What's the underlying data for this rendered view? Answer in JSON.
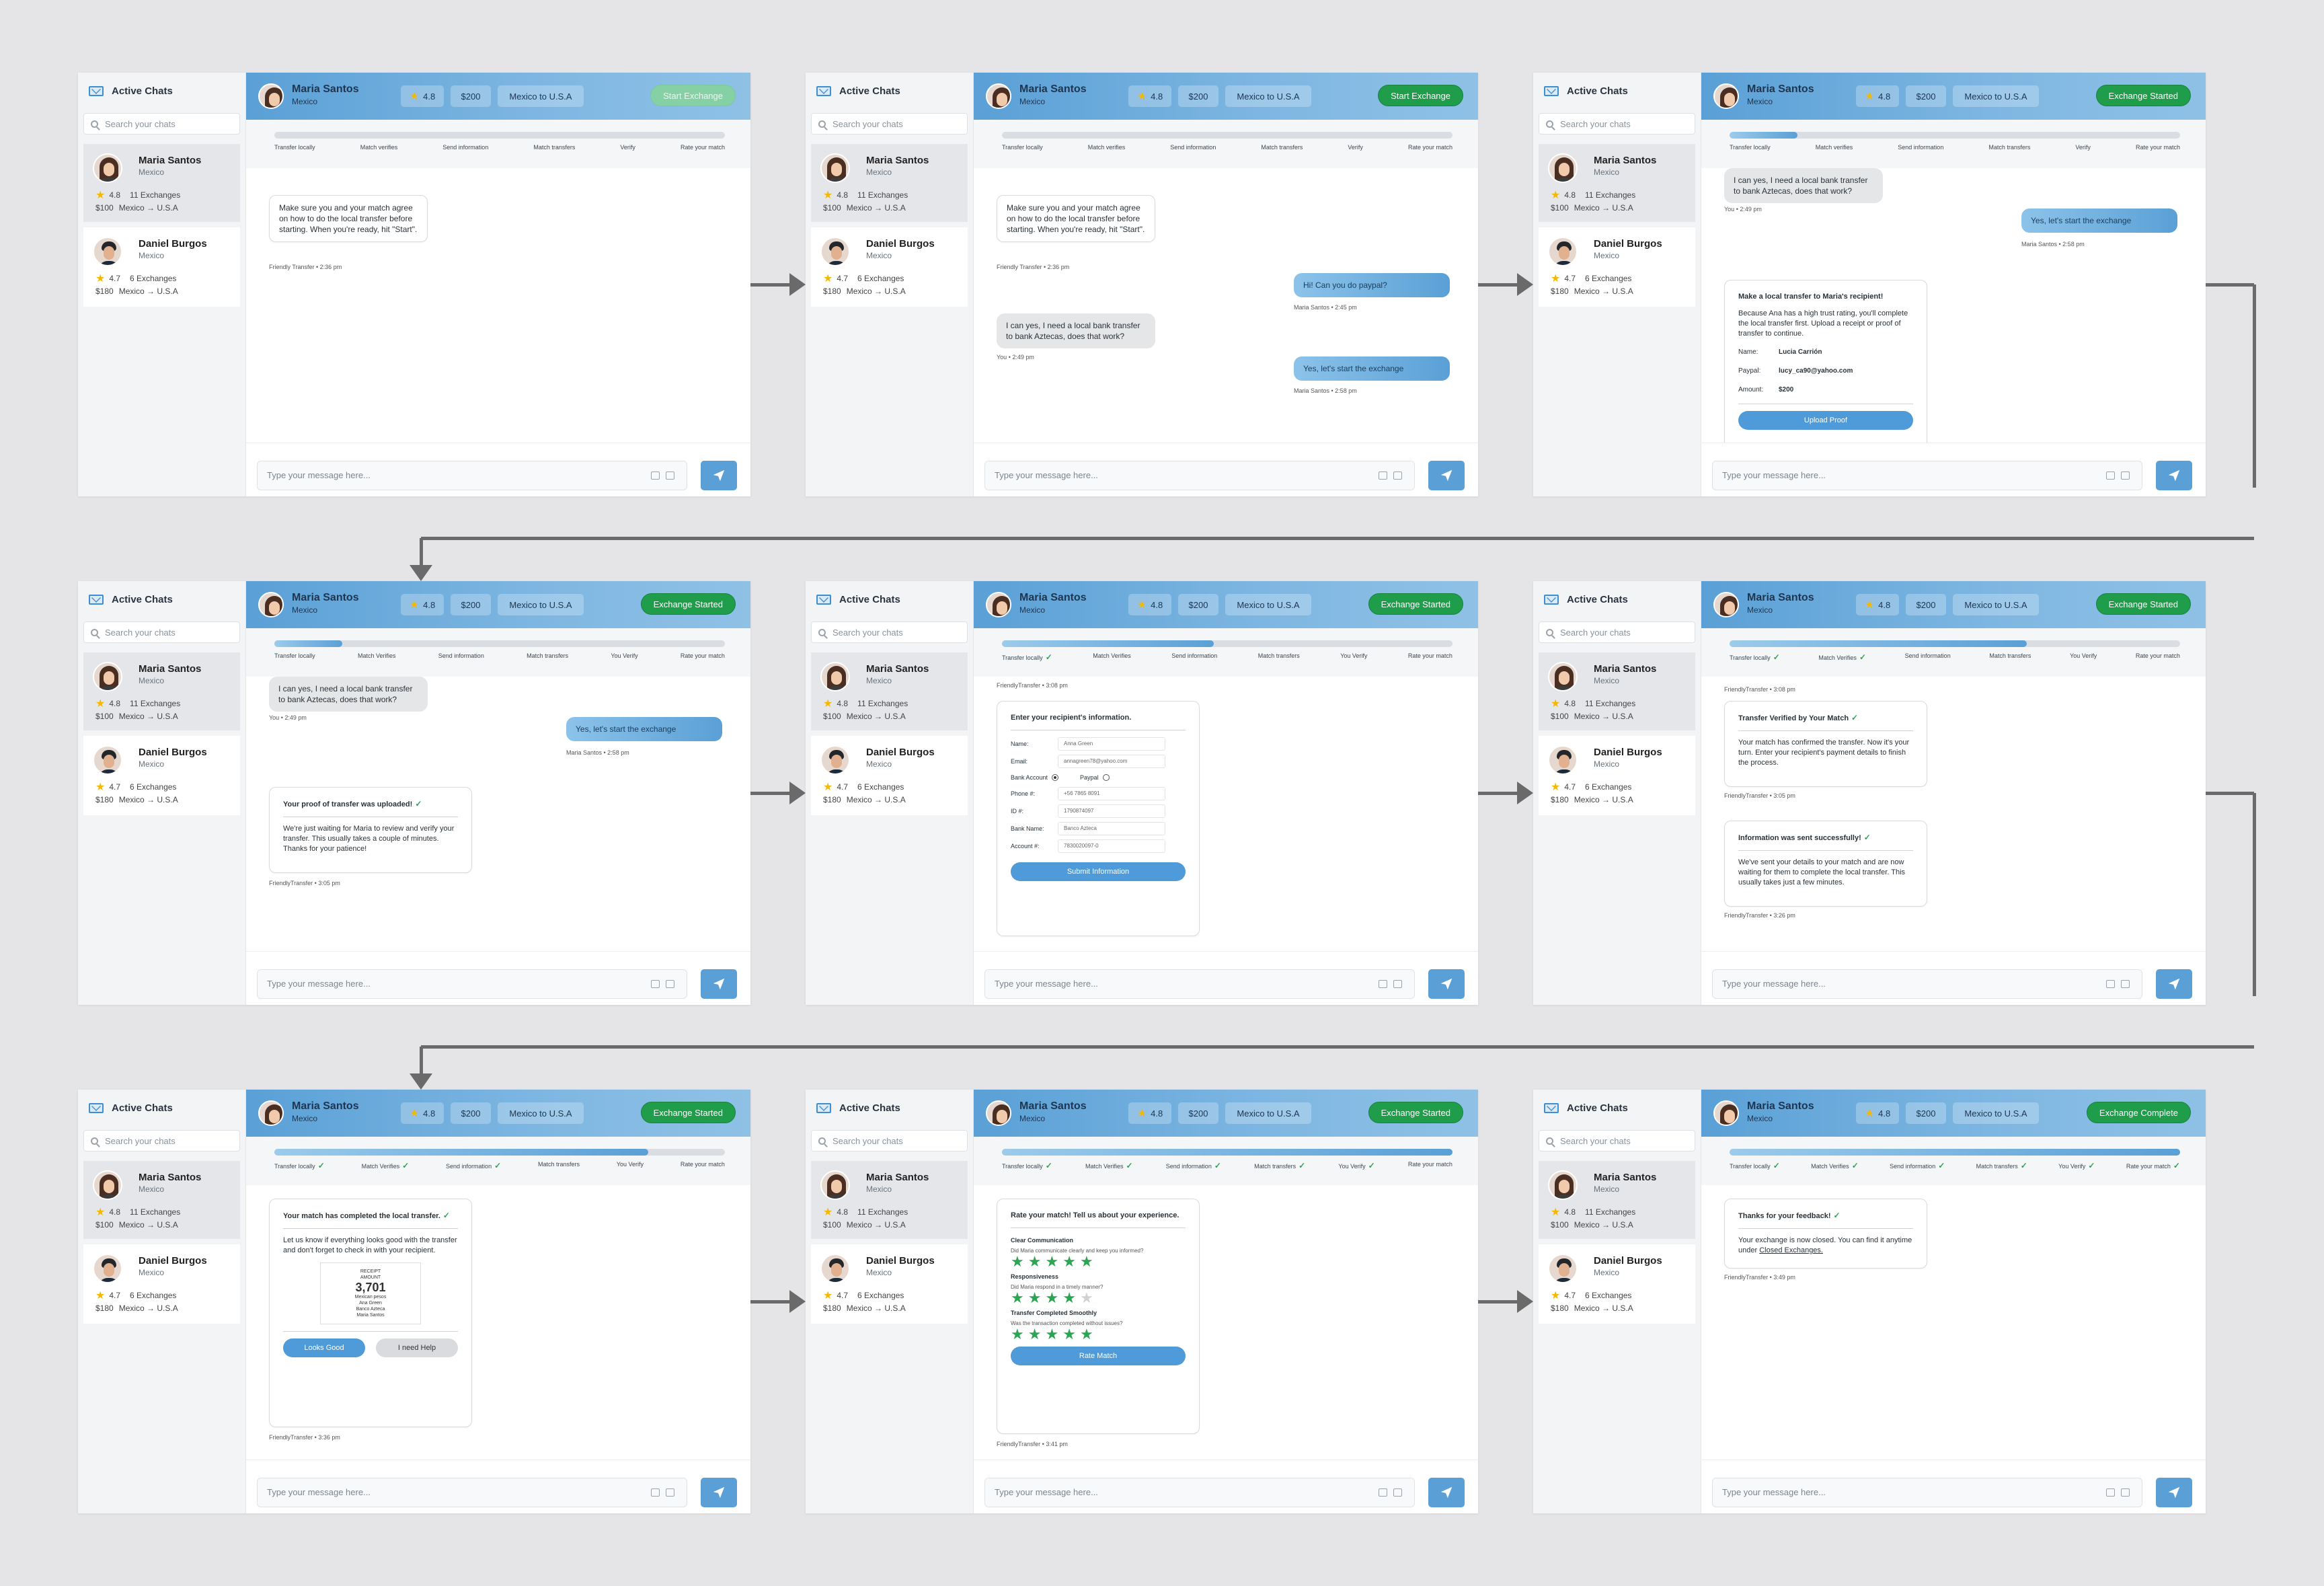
{
  "sidebar": {
    "title": "Active Chats",
    "search_placeholder": "Search your chats",
    "contacts": [
      {
        "name": "Maria Santos",
        "country": "Mexico",
        "rating": "4.8",
        "exchanges": "11 Exchanges",
        "amount": "$100",
        "route": "Mexico → U.S.A"
      },
      {
        "name": "Daniel Burgos",
        "country": "Mexico",
        "rating": "4.7",
        "exchanges": "6 Exchanges",
        "amount": "$180",
        "route": "Mexico → U.S.A"
      }
    ]
  },
  "header": {
    "name": "Maria Santos",
    "country": "Mexico",
    "rating": "4.8",
    "amount": "$200",
    "route": "Mexico to U.S.A"
  },
  "buttons": {
    "start": "Start Exchange",
    "started": "Exchange Started",
    "complete": "Exchange Complete"
  },
  "steps": [
    "Transfer locally",
    "Match verifies",
    "Send information",
    "Match transfers",
    "Verify",
    "Rate your match"
  ],
  "steps_later": [
    "Transfer locally",
    "Match Verifies",
    "Send information",
    "Match transfers",
    "You Verify",
    "Rate your match"
  ],
  "input_placeholder": "Type your message here...",
  "frames": [
    {
      "button": "start_dim",
      "progress": 0.0
    },
    {
      "button": "start",
      "progress": 0.0
    },
    {
      "button": "started",
      "progress": 0.15
    },
    {
      "button": "started",
      "progress": 0.15
    },
    {
      "button": "started",
      "progress": 0.47
    },
    {
      "button": "started",
      "progress": 0.66
    },
    {
      "button": "started",
      "progress": 0.83
    },
    {
      "button": "started",
      "progress": 1.0
    },
    {
      "button": "complete",
      "progress": 1.0
    }
  ],
  "messages": {
    "intro": "Make sure you and your match agree on how to do the local transfer before starting. When you're ready, hit \"Start\".",
    "intro_meta": "Friendly Transfer • 2:36 pm",
    "paypal_q": "Hi! Can you do paypal?",
    "paypal_meta": "Maria Santos • 2:45 pm",
    "bank_reply": "I can yes, I need a local bank transfer to bank Aztecas, does that work?",
    "bank_meta": "You • 2:49 pm",
    "start_msg": "Yes, let's start the exchange",
    "start_meta": "Maria Santos • 2:58 pm",
    "transfer_title": "Make a local transfer to Maria's recipient!",
    "transfer_body": "Because Ana has a high trust rating, you'll complete the local transfer first. Upload a receipt or proof of transfer to continue.",
    "transfer_name_label": "Name:",
    "transfer_name": "Lucia Carrión",
    "transfer_paypal_label": "Paypal:",
    "transfer_paypal": "lucy_ca90@yahoo.com",
    "transfer_amount_label": "Amount:",
    "transfer_amount": "$200",
    "upload_btn": "Upload Proof",
    "proof_title": "Your proof of transfer was uploaded!",
    "proof_body": "We're just waiting for Maria to review and verify your transfer. This usually takes a couple of minutes. Thanks for your patience!",
    "proof_meta": "FriendlyTransfer • 3:05 pm",
    "recipient_meta": "FriendlyTransfer • 3:08 pm",
    "recipient_title": "Enter your recipient's information.",
    "recipient_fields": [
      {
        "label": "Name:",
        "value": "Anna Green"
      },
      {
        "label": "Email:",
        "value": "annagreen78@yahoo.com"
      },
      {
        "label": "Phone #:",
        "value": "+56 7865 8091"
      },
      {
        "label": "ID #:",
        "value": "1790874097"
      },
      {
        "label": "Bank Name:",
        "value": "Banco Azteca"
      },
      {
        "label": "Account #:",
        "value": "7830020097-0"
      }
    ],
    "bank_account": "Bank Account",
    "paypal_opt": "Paypal",
    "submit_btn": "Submit Information",
    "verified_title": "Transfer Verified by Your Match",
    "verified_body": "Your match has confirmed the transfer. Now it's your turn. Enter your recipient's payment details to finish the process.",
    "verified_meta": "FriendlyTransfer • 3:05 pm",
    "sent_title": "Information was sent successfully!",
    "sent_body": "We've sent your details to your match and are now waiting for them to complete the local transfer. This usually takes just a few minutes.",
    "sent_meta": "FriendlyTransfer • 3:26 pm",
    "completed_title": "Your match has completed the local transfer.",
    "completed_body": "Let us know if everything looks good with the transfer and don't forget to check in with your recipient.",
    "receipt_head": "RECEIPT",
    "receipt_small": "AMOUNT",
    "receipt_amount": "3,701",
    "receipt_currency": "Mexican pesos",
    "receipt_l1": "Ana Green",
    "receipt_l2": "Banco Azteca",
    "receipt_l3": "Maria Santos",
    "looks_good": "Looks Good",
    "need_help": "I need Help",
    "completed_meta": "FriendlyTransfer • 3:36 pm",
    "rate_title": "Rate your match! Tell us about your experience.",
    "rate_items": [
      {
        "title": "Clear Communication",
        "sub": "Did Maria communicate clearly and keep you informed?",
        "stars": 5
      },
      {
        "title": "Responsiveness",
        "sub": "Did Maria respond in a timely manner?",
        "stars": 4
      },
      {
        "title": "Transfer Completed Smoothly",
        "sub": "Was the transaction completed without issues?",
        "stars": 5
      }
    ],
    "rate_btn": "Rate Match",
    "rate_meta": "FriendlyTransfer • 3:41 pm",
    "thanks_title": "Thanks for your feedback!",
    "thanks_body": "Your exchange is now closed. You can find it anytime under",
    "thanks_link": "Closed Exchanges.",
    "thanks_meta": "FriendlyTransfer • 3:49 pm"
  },
  "colors": {
    "accent": "#5aa0d6",
    "success": "#1f9d4a",
    "background": "#e5e5e7"
  },
  "icons": [
    "mail-icon",
    "search-icon",
    "star-icon",
    "check-icon",
    "send-icon",
    "emoji-icon",
    "image-icon",
    "flow-arrow-icon"
  ]
}
